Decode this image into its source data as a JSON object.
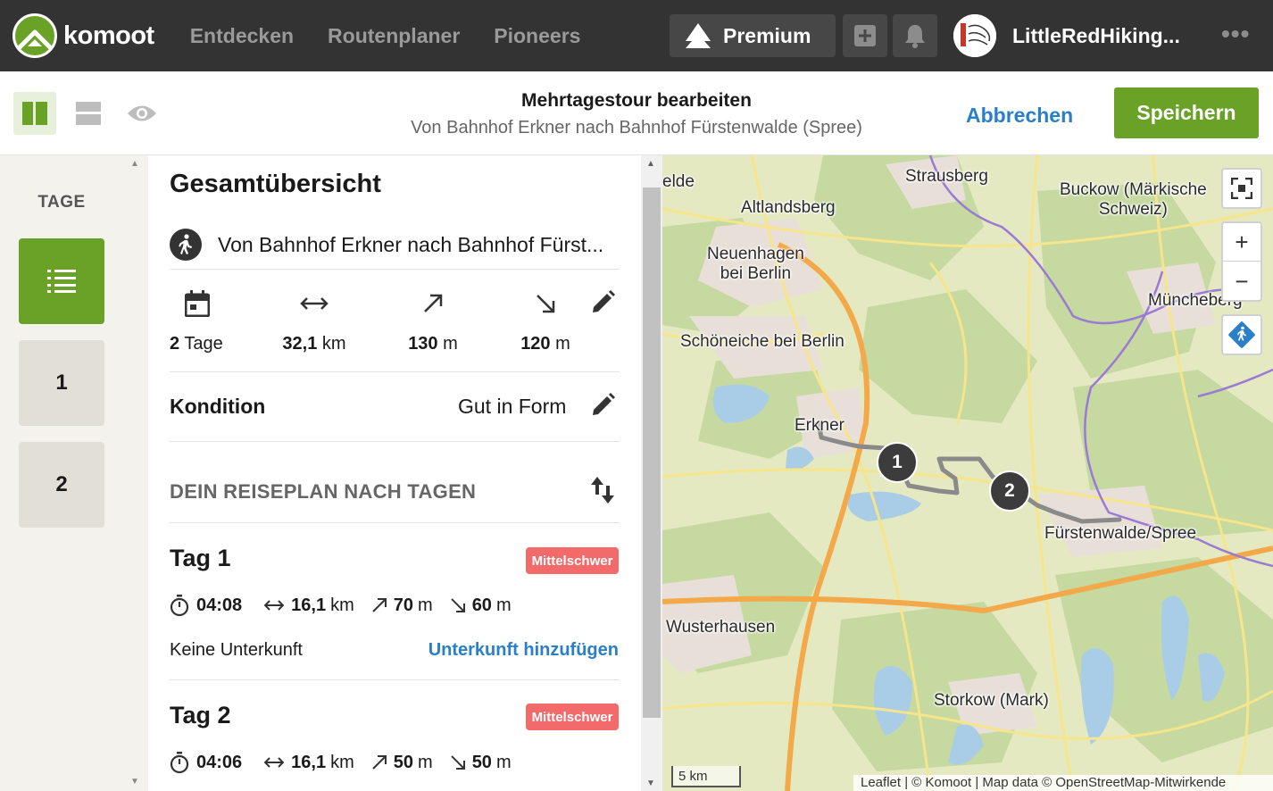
{
  "app": {
    "logo_text": "komoot",
    "nav": [
      "Entdecken",
      "Routenplaner",
      "Pioneers"
    ],
    "premium_label": "Premium",
    "username": "LittleRedHiking...",
    "more_label": "•••"
  },
  "header": {
    "title": "Mehrtagestour bearbeiten",
    "subtitle": "Von Bahnhof Erkner nach Bahnhof Fürstenwalde (Spree)",
    "cancel_label": "Abbrechen",
    "save_label": "Speichern"
  },
  "days_sidebar": {
    "title": "TAGE",
    "tiles": [
      "1",
      "2"
    ]
  },
  "overview": {
    "title": "Gesamtübersicht",
    "tour_name": "Von Bahnhof Erkner nach Bahnhof Fürst...",
    "stats": {
      "days_value": "2",
      "days_unit": "Tage",
      "distance_value": "32,1",
      "distance_unit": "km",
      "up_value": "130",
      "up_unit": "m",
      "down_value": "120",
      "down_unit": "m"
    },
    "condition_label": "Kondition",
    "condition_value": "Gut in Form",
    "plan_label": "DEIN REISEPLAN NACH TAGEN",
    "days": [
      {
        "title": "Tag 1",
        "difficulty": "Mittelschwer",
        "duration": "04:08",
        "distance_value": "16,1",
        "distance_unit": "km",
        "up_value": "70",
        "up_unit": "m",
        "down_value": "60",
        "down_unit": "m",
        "accommodation": "Keine Unterkunft",
        "accommodation_link": "Unterkunft hinzufügen"
      },
      {
        "title": "Tag 2",
        "difficulty": "Mittelschwer",
        "duration": "04:06",
        "distance_value": "16,1",
        "distance_unit": "km",
        "up_value": "50",
        "up_unit": "m",
        "down_value": "50",
        "down_unit": "m"
      }
    ]
  },
  "map": {
    "labels": {
      "elde": "elde",
      "strausberg": "Strausberg",
      "buckow": "Buckow (Märkische\nSchweiz)",
      "altlandsberg": "Altlandsberg",
      "neuenhagen": "Neuenhagen\nbei Berlin",
      "muencheberg": "Müncheberg",
      "schoeneiche": "Schöneiche bei Berlin",
      "erkner": "Erkner",
      "fuerstenwalde": "Fürstenwalde/Spree",
      "wusterhausen": "Wusterhausen",
      "storkow": "Storkow (Mark)"
    },
    "markers": [
      "1",
      "2"
    ],
    "zoom_in": "+",
    "zoom_out": "−",
    "scale": "5 km",
    "attribution": "Leaflet | © Komoot | Map data © OpenStreetMap-Mitwirkende"
  },
  "colors": {
    "brand_green": "#6aa127",
    "link_blue": "#2a7fc9",
    "badge_red": "#f26a6a",
    "topbar": "#333333"
  }
}
